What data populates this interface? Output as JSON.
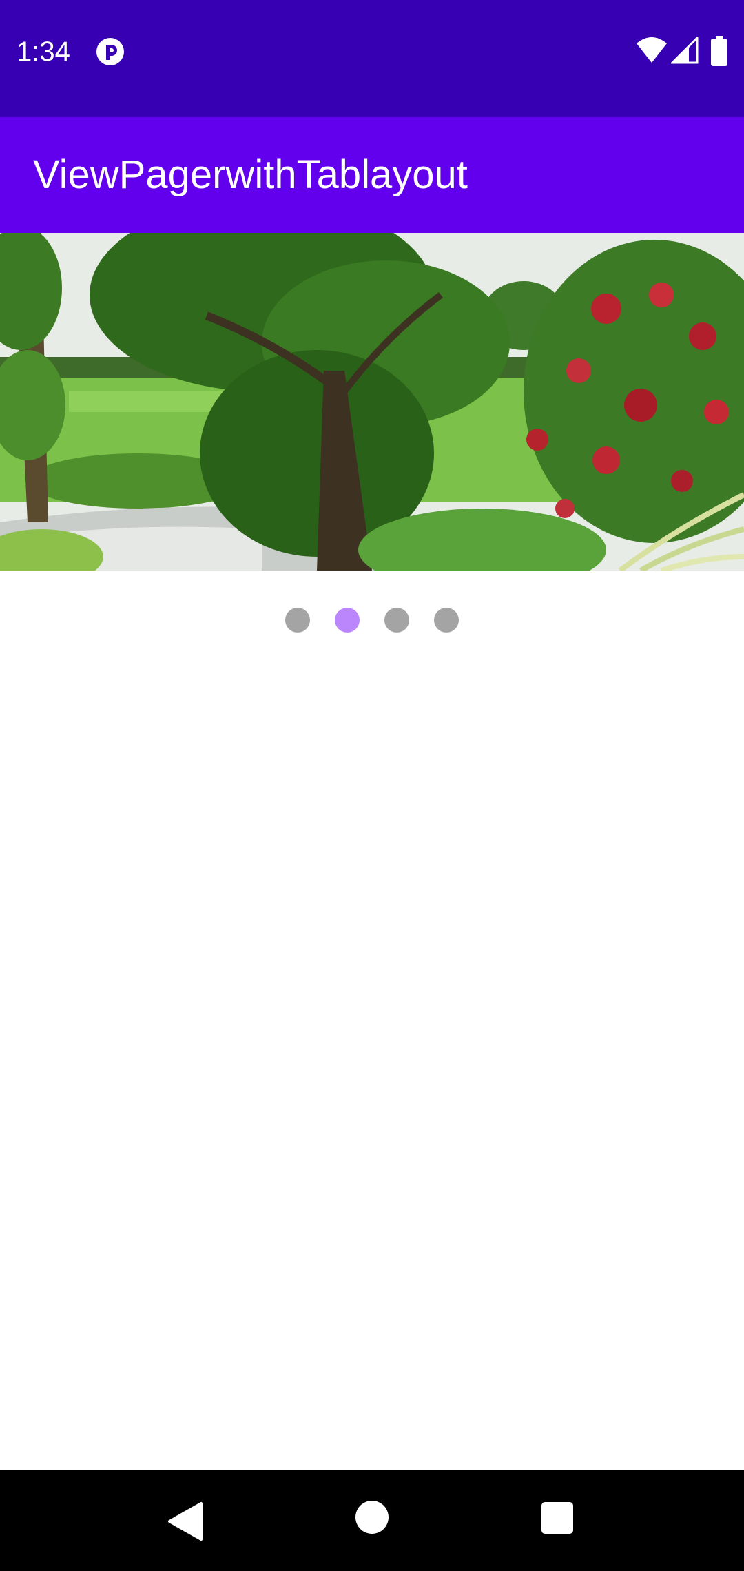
{
  "status_bar": {
    "time": "1:34",
    "icons": [
      "app-notification-icon",
      "wifi-icon",
      "cell-signal-icon",
      "battery-icon"
    ],
    "background": "#3700B3"
  },
  "app_bar": {
    "title": "ViewPagerwithTablayout",
    "background": "#6200EE"
  },
  "pager": {
    "image": "landscape-photo-tree-pond-garden",
    "page_count": 4,
    "selected_index": 1
  },
  "indicator": {
    "active_color": "#BB86FC",
    "inactive_color": "#A4A4A4"
  },
  "nav_bar": {
    "icons": [
      "back-icon",
      "home-icon",
      "recents-icon"
    ]
  }
}
